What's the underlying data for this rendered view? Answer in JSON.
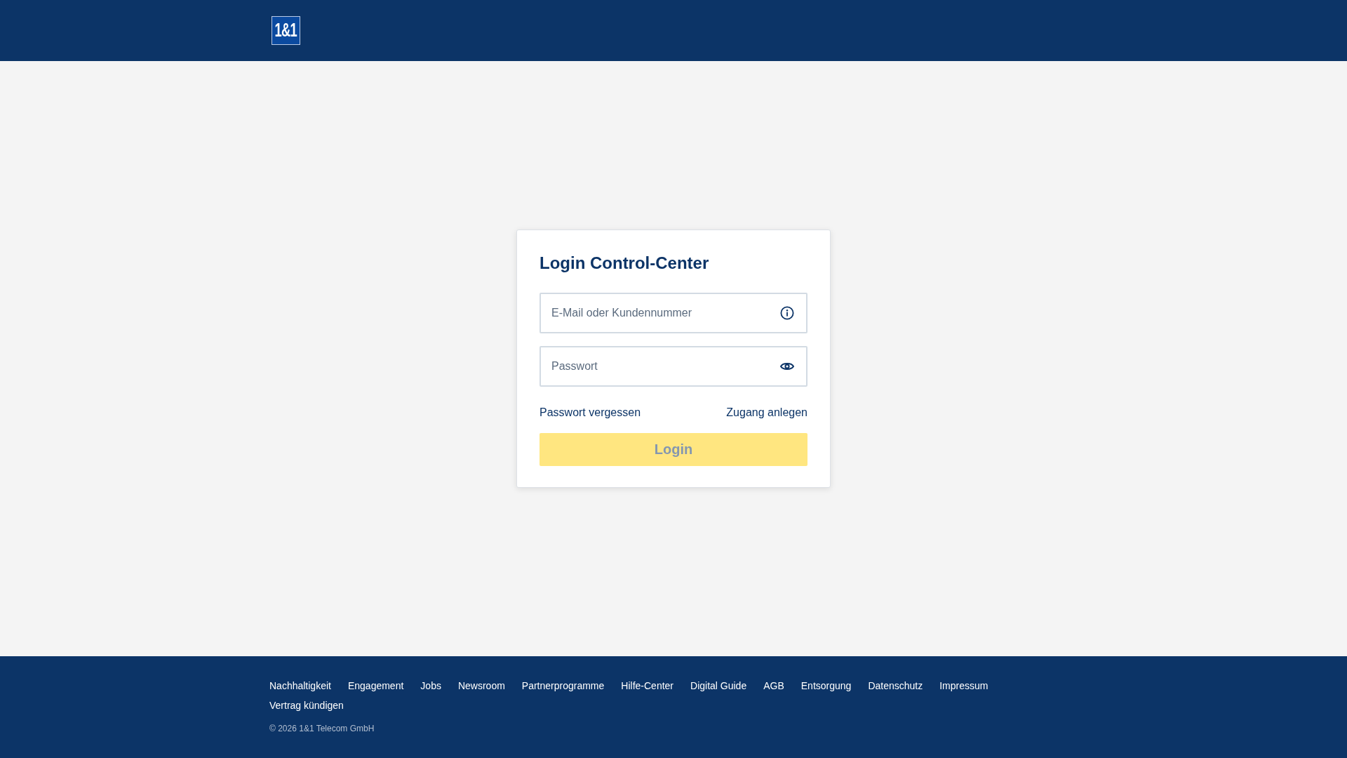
{
  "header": {
    "logo": "1&1"
  },
  "login": {
    "title": "Login Control-Center",
    "fields": [
      {
        "kind": "email",
        "placeholder": "E-Mail oder Kundennummer"
      },
      {
        "kind": "password",
        "placeholder": "Passwort"
      }
    ],
    "links": [
      "Passwort vergessen",
      "Zugang anlegen"
    ],
    "button": {
      "label": "Login",
      "disabled": true
    }
  },
  "footer": {
    "links": [
      "Nachhaltigkeit",
      "Engagement",
      "Jobs",
      "Newsroom",
      "Partnerprogramme",
      "Hilfe-Center",
      "Digital Guide",
      "AGB",
      "Entsorgung",
      "Datenschutz",
      "Impressum",
      "Vertrag kündigen"
    ],
    "copyright": "© 2026 1&1 Telecom GmbH"
  }
}
